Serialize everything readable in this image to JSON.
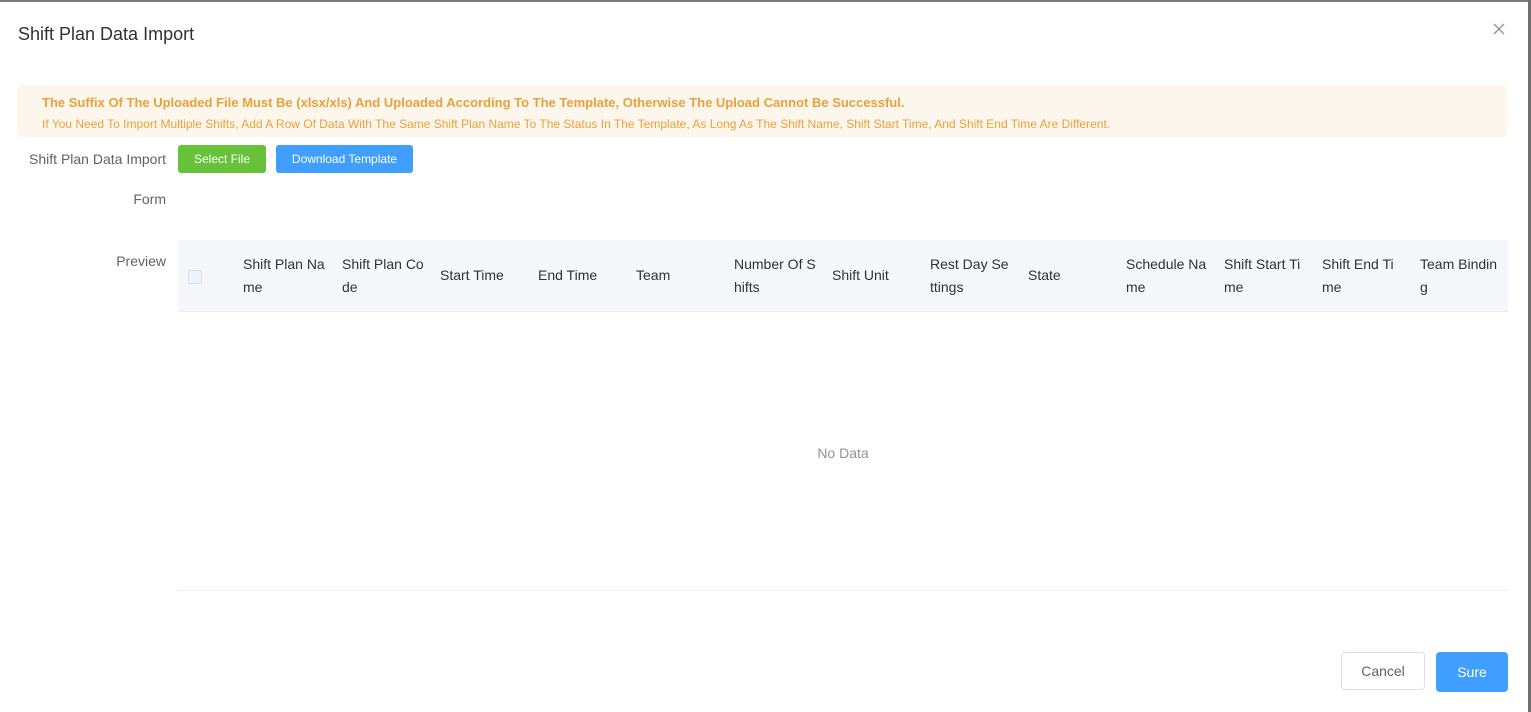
{
  "dialog": {
    "title": "Shift Plan Data Import",
    "close_icon": "close-icon"
  },
  "alert": {
    "title": "The Suffix Of The Uploaded File Must Be (xlsx/xls) And Uploaded According To The Template, Otherwise The Upload Cannot Be Successful.",
    "description": "If You Need To Import Multiple Shifts, Add A Row Of Data With The Same Shift Plan Name To The Status In The Template, As Long As The Shift Name, Shift Start Time, And Shift End Time Are Different.",
    "color": "#e6a23c",
    "background": "#fdf6ec"
  },
  "form": {
    "import_label": "Shift Plan Data Import",
    "form_label": "Form",
    "preview_label": "Preview",
    "select_file_label": "Select File",
    "download_template_label": "Download Template"
  },
  "table": {
    "columns": [
      "Shift Plan Name",
      "Shift Plan Code",
      "Start Time",
      "End Time",
      "Team",
      "Number Of Shifts",
      "Shift Unit",
      "Rest Day Settings",
      "State",
      "Schedule Name",
      "Shift Start Time",
      "Shift End Time",
      "Team Binding"
    ],
    "empty_text": "No Data"
  },
  "footer": {
    "cancel_label": "Cancel",
    "sure_label": "Sure"
  },
  "colors": {
    "primary": "#409eff",
    "success": "#67c23a",
    "warning": "#e6a23c"
  }
}
